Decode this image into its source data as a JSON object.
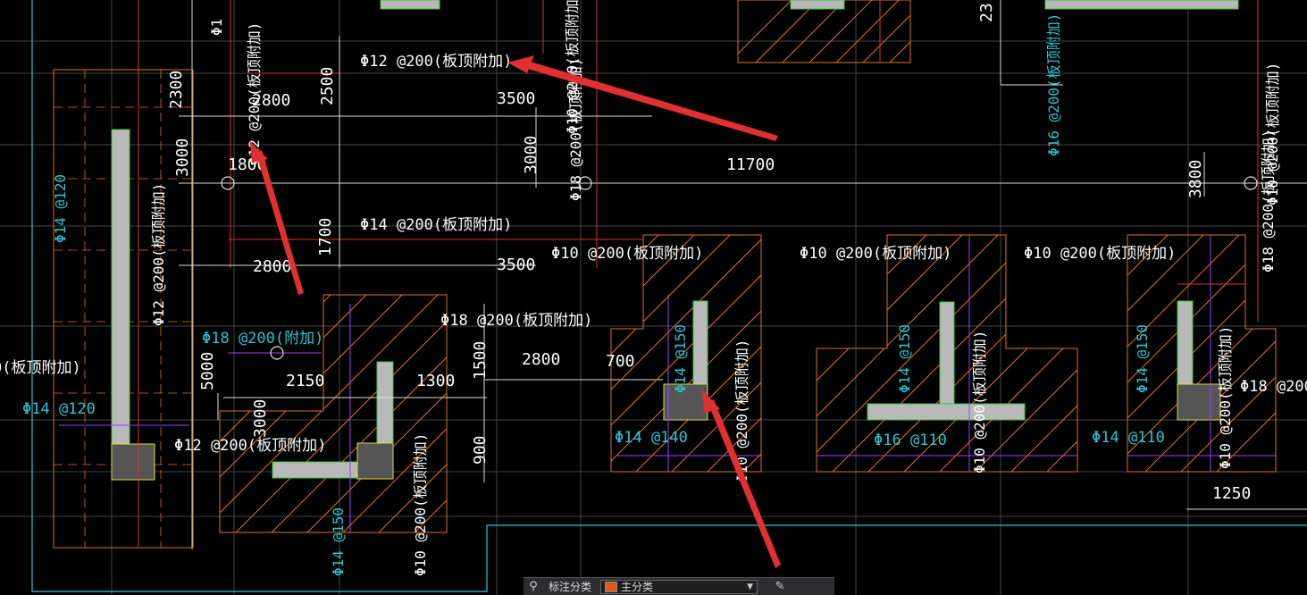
{
  "app": {
    "status_bar": {
      "label": "标注分类",
      "layer_value": "主分类",
      "layer_color": "#e05a1a",
      "left_icon": "binoculars-icon",
      "right_icon": "pencil-settings-icon"
    }
  },
  "colors": {
    "background": "#000000",
    "rebar_label": "#ffffff",
    "rebar_cyan": "#29c5d6",
    "dimension": "#ffffff",
    "hatch": "#e07020",
    "arrow": "#e03030"
  },
  "drawing": {
    "top_labels": [
      "Φ12 @200(板顶附加)",
      "Φ14 @200(板顶附加)",
      "Φ10 @200(板顶附加)",
      "Φ10 @200(板顶附加)",
      "Φ10 @200(板顶附加)",
      "Φ18 @200(板顶附加)",
      "Φ12 @200(板顶附加)",
      "Φ18 @200(附加)"
    ],
    "vertical_labels": [
      "Φ12 @200(板顶附加)",
      "Φ12 @200(板顶附加)",
      "Φ18 @200(板顶附加)",
      "Φ16 @200(板顶附加)",
      "Φ18 @200(板顶附加)",
      "Φ10 @200(板顶附加)",
      "Φ10 @200(板顶附加)",
      "Φ10 @200(板顶附加)",
      "Φ10 @200(板顶附加)",
      "Φ10 @200(板顶附加)",
      "Φ10 @200(板顶附加)"
    ],
    "cyan_labels": [
      "Φ14 @120",
      "Φ14 @120",
      "Φ14 @150",
      "Φ14 @140",
      "Φ14 @150",
      "Φ16 @110",
      "Φ14 @150",
      "Φ14 @110",
      "Φ14 @150"
    ],
    "dimensions": [
      "2300",
      "2800",
      "2500",
      "3500",
      "3000",
      "3000",
      "1800",
      "11700",
      "3800",
      "1700",
      "2800",
      "3500",
      "5000",
      "2150",
      "1300",
      "1500",
      "2800",
      "700",
      "3000",
      "900",
      "1250",
      "23"
    ],
    "fragments": [
      "0(板顶附加)",
      "Φ18 @200",
      "Φ1"
    ]
  }
}
